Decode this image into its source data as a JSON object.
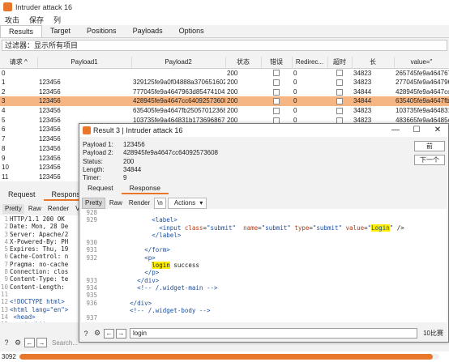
{
  "main_window": {
    "title": "Intruder attack 16",
    "menu": [
      "攻击",
      "保存",
      "列"
    ],
    "tabs": [
      "Results",
      "Target",
      "Positions",
      "Payloads",
      "Options"
    ],
    "active_tab": "Results",
    "filter_text": "过滤器：显示所有项目"
  },
  "table": {
    "headers": [
      "请求",
      "Payload1",
      "Payload2",
      "状态",
      "错误",
      "Redirec...",
      "超时",
      "长",
      "value=\""
    ],
    "rows": [
      {
        "req": "0",
        "p1": "",
        "p2": "",
        "status": "200",
        "redir": "0",
        "len": "34823",
        "val": "265745fe9a464767"
      },
      {
        "req": "1",
        "p1": "123456",
        "p2": "329125fe9a0f04888a370651602",
        "status": "200",
        "redir": "0",
        "len": "34823",
        "val": "277045fe9a464796"
      },
      {
        "req": "2",
        "p1": "123456",
        "p2": "777045fe9a4647963d854741043",
        "status": "200",
        "redir": "0",
        "len": "34844",
        "val": "428945fe9a4647cc"
      },
      {
        "req": "3",
        "p1": "123456",
        "p2": "428945fe9a4647cc64092573608",
        "status": "200",
        "redir": "0",
        "len": "34844",
        "val": "635405fe9a4647fb"
      },
      {
        "req": "4",
        "p1": "123456",
        "p2": "635405fe9a4647fb25057012368",
        "status": "200",
        "redir": "0",
        "len": "34823",
        "val": "103735fe9a464831"
      },
      {
        "req": "5",
        "p1": "123456",
        "p2": "103735fe9a464831b1736968670",
        "status": "200",
        "redir": "0",
        "len": "34823",
        "val": "483665fe9a46485c"
      },
      {
        "req": "6",
        "p1": "123456",
        "p2": "",
        "status": "",
        "redir": "",
        "len": "",
        "val": ""
      },
      {
        "req": "7",
        "p1": "123456",
        "p2": "",
        "status": "",
        "redir": "",
        "len": "",
        "val": ""
      },
      {
        "req": "8",
        "p1": "123456",
        "p2": "",
        "status": "",
        "redir": "",
        "len": "",
        "val": ""
      },
      {
        "req": "9",
        "p1": "123456",
        "p2": "",
        "status": "",
        "redir": "",
        "len": "",
        "val": ""
      },
      {
        "req": "10",
        "p1": "123456",
        "p2": "",
        "status": "",
        "redir": "",
        "len": "",
        "val": ""
      },
      {
        "req": "11",
        "p1": "123456",
        "p2": "",
        "status": "",
        "redir": "",
        "len": "",
        "val": ""
      }
    ],
    "selected_row": 3
  },
  "bottom_panel": {
    "tabs": [
      "Request",
      "Response"
    ],
    "active_tab": "Response",
    "viewer_tabs": [
      "Pretty",
      "Raw",
      "Render",
      "V"
    ],
    "code_lines": [
      {
        "n": "1",
        "t": "HTTP/1.1 200 OK"
      },
      {
        "n": "2",
        "t": "Date: Mon, 28 De"
      },
      {
        "n": "3",
        "t": "Server: Apache/2"
      },
      {
        "n": "4",
        "t": "X-Powered-By: PH"
      },
      {
        "n": "5",
        "t": "Expires: Thu, 19"
      },
      {
        "n": "6",
        "t": "Cache-Control: n"
      },
      {
        "n": "7",
        "t": "Pragma: no-cache"
      },
      {
        "n": "8",
        "t": "Connection: clos"
      },
      {
        "n": "9",
        "t": "Content-Type: te"
      },
      {
        "n": "10",
        "t": "Content-Length:"
      },
      {
        "n": "11",
        "t": ""
      },
      {
        "n": "12",
        "t": "<!DOCTYPE html>"
      },
      {
        "n": "13",
        "t": "<html lang=\"en\">"
      },
      {
        "n": "14",
        "t": "  <head>"
      },
      {
        "n": "15",
        "t": "    <meta http-e"
      },
      {
        "n": "16",
        "t": "    <meta charse"
      }
    ],
    "search_placeholder": "Search..."
  },
  "status": {
    "count": "3092",
    "progress": 0.985
  },
  "dialog": {
    "title": "Result 3 | Intruder attack 16",
    "info": [
      {
        "k": "Payload 1:",
        "v": "123456"
      },
      {
        "k": "Payload 2:",
        "v": "428945fe9a4647cc64092573608"
      },
      {
        "k": "Status:",
        "v": "200"
      },
      {
        "k": "Length:",
        "v": "34844"
      },
      {
        "k": "Timer:",
        "v": "9"
      }
    ],
    "prev_label": "前",
    "next_label": "下一个",
    "tabs": [
      "Request",
      "Response"
    ],
    "active_tab": "Response",
    "viewer_tabs": [
      "Pretty",
      "Raw",
      "Render"
    ],
    "newline_toggle": "\\n",
    "actions_label": "Actions",
    "search_value": "login",
    "match_count": "10比赛"
  }
}
